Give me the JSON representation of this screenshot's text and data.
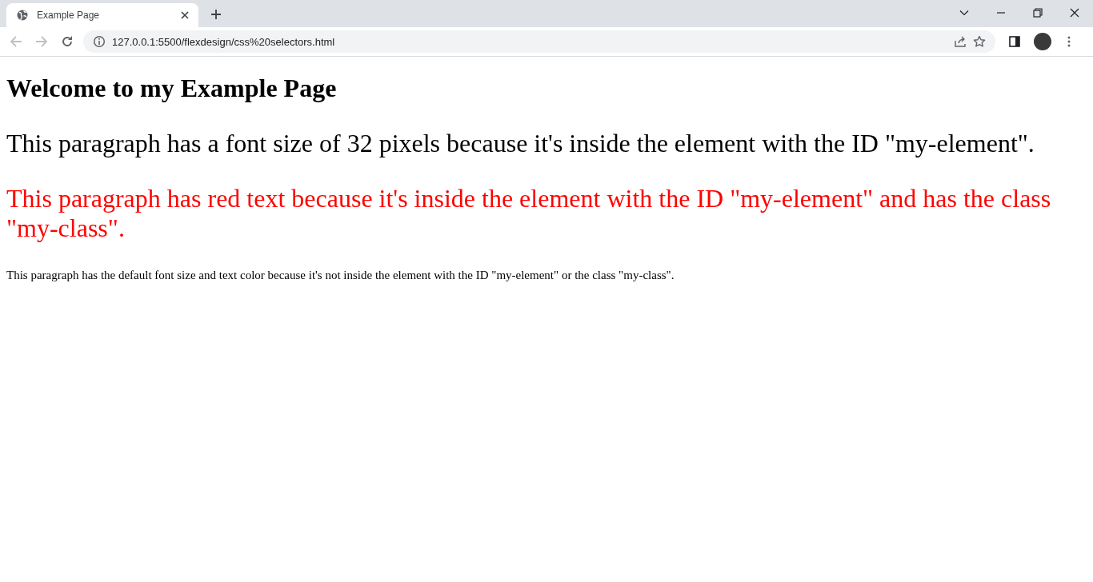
{
  "browser": {
    "tab": {
      "title": "Example Page",
      "selected": true
    },
    "back_disabled": true,
    "forward_disabled": true,
    "url": "127.0.0.1:5500/flexdesign/css%20selectors.html"
  },
  "page": {
    "heading": "Welcome to my Example Page",
    "paragraphs": [
      {
        "kind": "large",
        "text": "This paragraph has a font size of 32 pixels because it's inside the element with the ID \"my-element\"."
      },
      {
        "kind": "large-red",
        "text": "This paragraph has red text because it's inside the element with the ID \"my-element\" and has the class \"my-class\"."
      },
      {
        "kind": "default",
        "text": "This paragraph has the default font size and text color because it's not inside the element with the ID \"my-element\" or the class \"my-class\"."
      }
    ]
  }
}
